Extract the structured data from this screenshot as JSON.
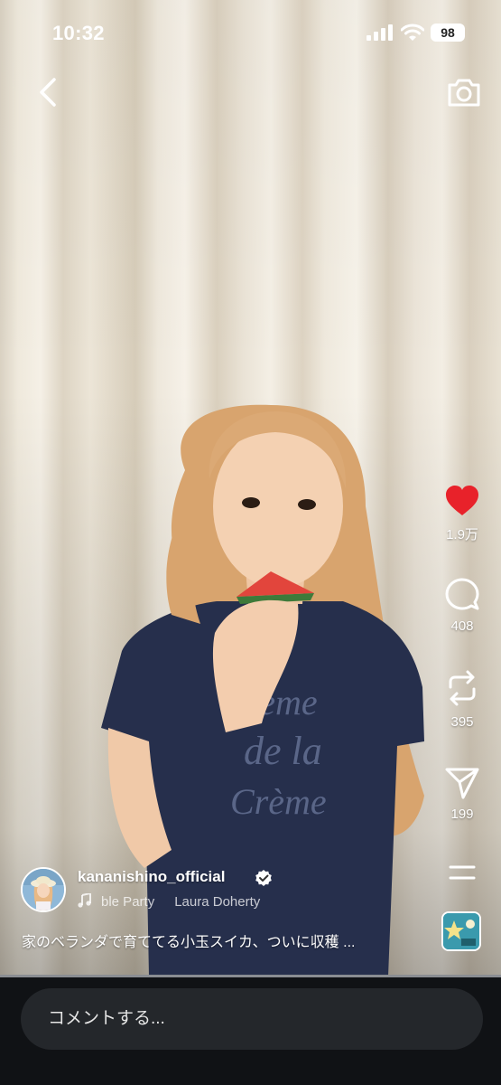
{
  "status_bar": {
    "time": "10:32",
    "battery": "98"
  },
  "post": {
    "username": "kananishino_official",
    "music_title": "ble Party",
    "music_artist": "Laura Doherty",
    "caption": "家のベランダで育ててる小玉スイカ、ついに収穫 ...",
    "progress_fraction": 1.0
  },
  "actions": {
    "likes": "1.9万",
    "comments": "408",
    "reposts": "395",
    "shares": "199"
  },
  "comment_input": {
    "placeholder": "コメントする..."
  },
  "colors": {
    "like": "#e8222a",
    "bottom_bar": "#101215",
    "input_bg": "#24272b"
  }
}
